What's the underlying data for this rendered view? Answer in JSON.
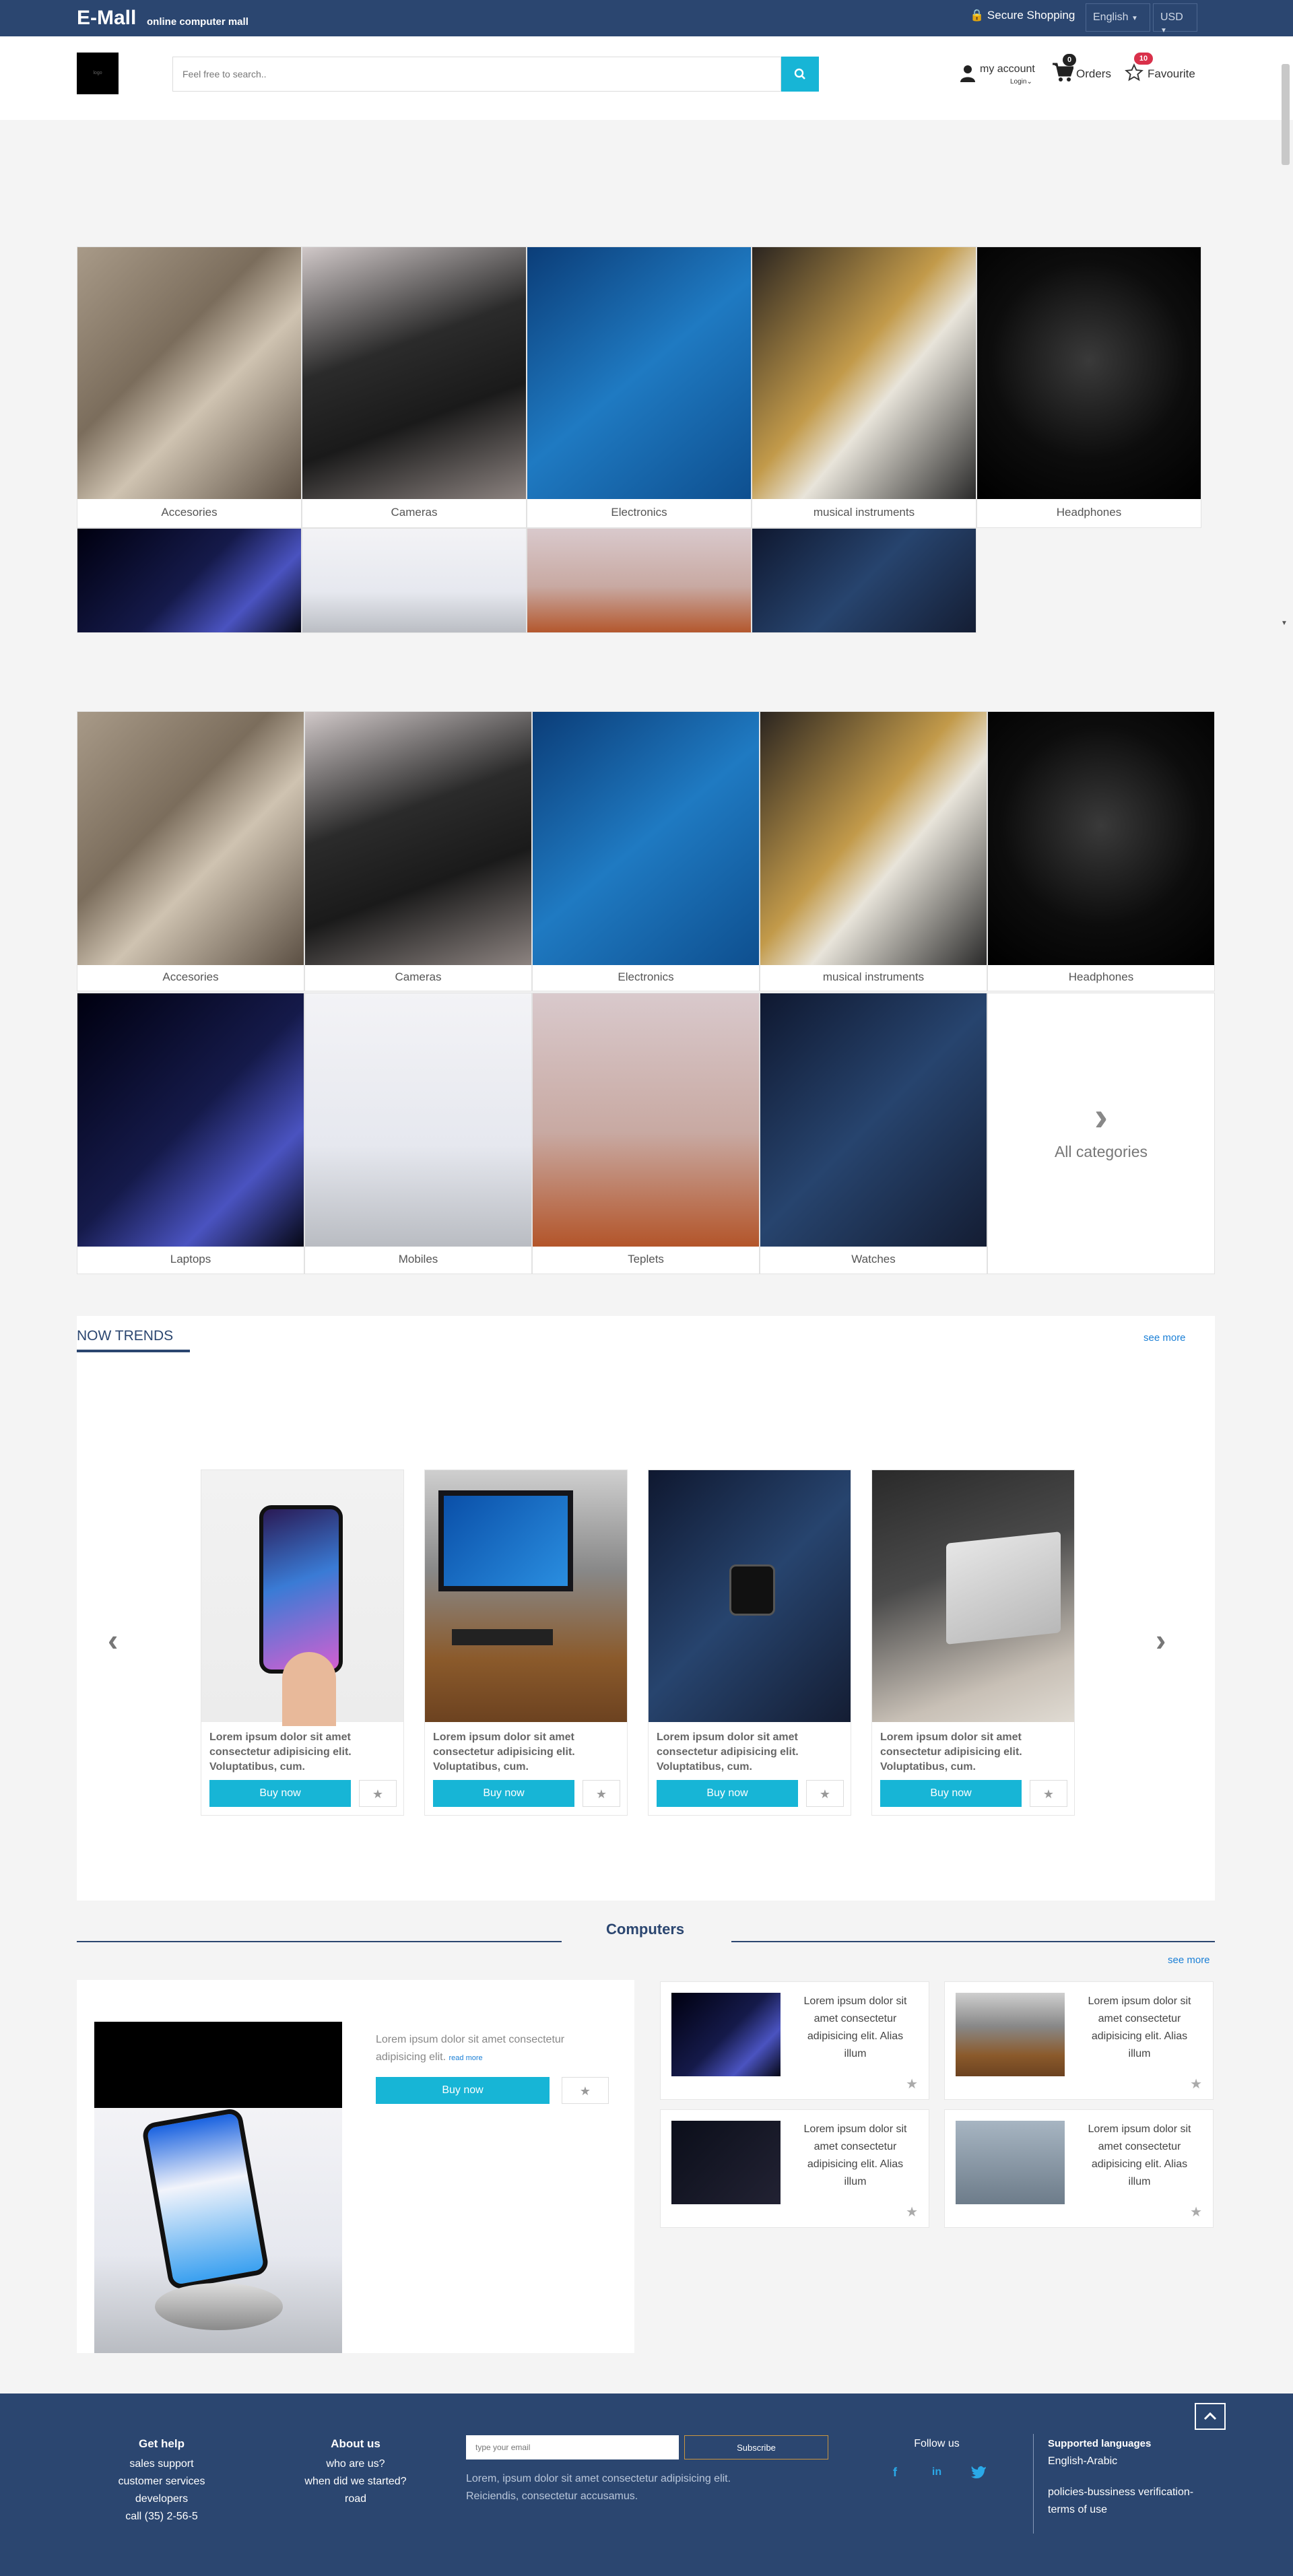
{
  "topbar": {
    "brand": "E-Mall",
    "tagline": "online computer mall",
    "secure": "Secure Shopping",
    "language": "English",
    "currency": "USD"
  },
  "header": {
    "logo_text": "logo",
    "search_placeholder": "Feel free to search..",
    "account_label": "my account",
    "login_label": "Login",
    "orders_label": "Orders",
    "orders_count": "0",
    "favourite_label": "Favourite",
    "favourite_count": "10"
  },
  "categories_preview": [
    {
      "label": "Accesories",
      "icon": "accessories-image"
    },
    {
      "label": "Cameras",
      "icon": "camera-image"
    },
    {
      "label": "Electronics",
      "icon": "arduino-image"
    },
    {
      "label": "musical instruments",
      "icon": "guitar-image"
    },
    {
      "label": "Headphones",
      "icon": "headphones-image"
    }
  ],
  "categories": [
    {
      "label": "Accesories",
      "icon": "accessories-image"
    },
    {
      "label": "Cameras",
      "icon": "camera-image"
    },
    {
      "label": "Electronics",
      "icon": "arduino-image"
    },
    {
      "label": "musical instruments",
      "icon": "guitar-image"
    },
    {
      "label": "Headphones",
      "icon": "headphones-image"
    },
    {
      "label": "Laptops",
      "icon": "laptop-image"
    },
    {
      "label": "Mobiles",
      "icon": "mobile-image"
    },
    {
      "label": "Teplets",
      "icon": "tablet-image"
    },
    {
      "label": "Watches",
      "icon": "watch-image"
    }
  ],
  "all_categories_label": "All categories",
  "trends": {
    "title": "NOW TRENDS",
    "see_more": "see more",
    "products": [
      {
        "text": "Lorem ipsum dolor sit amet consectetur adipisicing elit. Voluptatibus, cum.",
        "buy": "Buy now"
      },
      {
        "text": "Lorem ipsum dolor sit amet consectetur adipisicing elit. Voluptatibus, cum.",
        "buy": "Buy now"
      },
      {
        "text": "Lorem ipsum dolor sit amet consectetur adipisicing elit. Voluptatibus, cum.",
        "buy": "Buy now"
      },
      {
        "text": "Lorem ipsum dolor sit amet consectetur adipisicing elit. Voluptatibus, cum.",
        "buy": "Buy now"
      }
    ]
  },
  "computers": {
    "title": "Computers",
    "see_more": "see more",
    "featured": {
      "text": "Lorem ipsum dolor sit amet consectetur adipisicing elit.",
      "read_more": "read more",
      "buy": "Buy now"
    },
    "items": [
      {
        "text": "Lorem ipsum dolor sit amet consectetur adipisicing elit. Alias illum"
      },
      {
        "text": "Lorem ipsum dolor sit amet consectetur adipisicing elit. Alias illum"
      },
      {
        "text": "Lorem ipsum dolor sit amet consectetur adipisicing elit. Alias illum"
      },
      {
        "text": "Lorem ipsum dolor sit amet consectetur adipisicing elit. Alias illum"
      }
    ]
  },
  "footer": {
    "help_title": "Get help",
    "help_links": [
      "sales support",
      "customer services",
      "developers",
      "call (35) 2-56-5"
    ],
    "about_title": "About us",
    "about_links": [
      "who are us?",
      "when did we started?",
      "road"
    ],
    "email_placeholder": "type your email",
    "subscribe": "Subscribe",
    "blurb": "Lorem, ipsum dolor sit amet consectetur adipisicing elit. Reiciendis, consectetur accusamus.",
    "follow_title": "Follow us",
    "langs_title": "Supported languages",
    "langs": "English-Arabic",
    "policies": "policies-bussiness verification-terms of use"
  },
  "colors": {
    "navy": "#2b4670",
    "accent": "#17b5d6",
    "badge": "#d9304a"
  }
}
